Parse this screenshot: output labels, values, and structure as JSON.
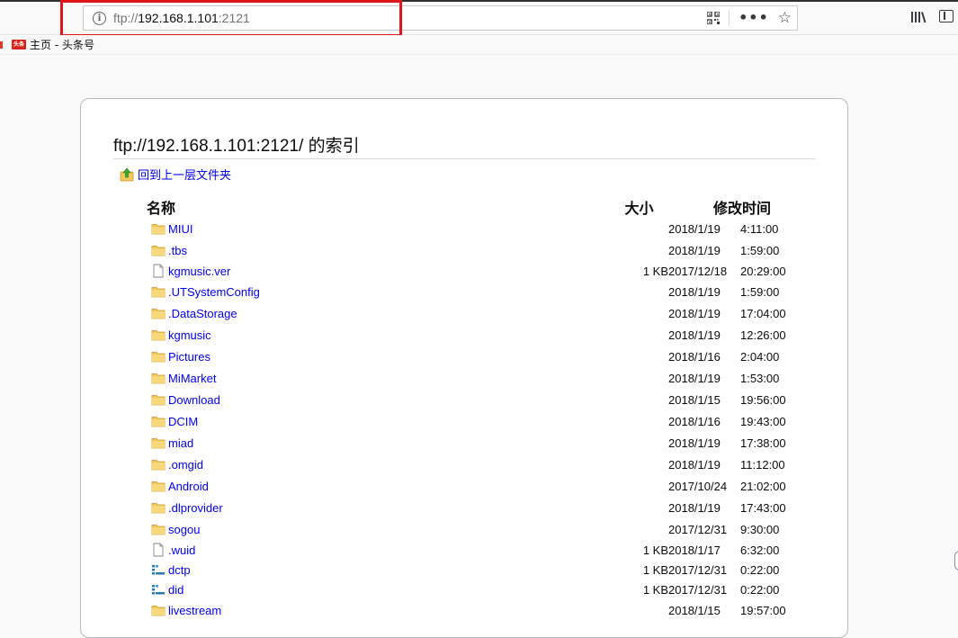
{
  "browser": {
    "url_scheme": "ftp://",
    "url_host": "192.168.1.101",
    "url_port": ":2121",
    "menu_dots": "•••",
    "star": "☆"
  },
  "bookmarks": [
    {
      "label": "主页 - 头条号",
      "favicon_text": "头条"
    }
  ],
  "page": {
    "title": "ftp://192.168.1.101:2121/ 的索引",
    "up_label": "回到上一层文件夹",
    "columns": {
      "name": "名称",
      "size": "大小",
      "modified": "修改时间"
    },
    "entries": [
      {
        "name": "MIUI",
        "type": "folder",
        "size": "",
        "date": "2018/1/19",
        "time": "4:11:00"
      },
      {
        "name": ".tbs",
        "type": "folder",
        "size": "",
        "date": "2018/1/19",
        "time": "1:59:00"
      },
      {
        "name": "kgmusic.ver",
        "type": "file",
        "size": "1 KB",
        "date": "2017/12/18",
        "time": "20:29:00"
      },
      {
        "name": ".UTSystemConfig",
        "type": "folder",
        "size": "",
        "date": "2018/1/19",
        "time": "1:59:00"
      },
      {
        "name": ".DataStorage",
        "type": "folder",
        "size": "",
        "date": "2018/1/19",
        "time": "17:04:00"
      },
      {
        "name": "kgmusic",
        "type": "folder",
        "size": "",
        "date": "2018/1/19",
        "time": "12:26:00"
      },
      {
        "name": "Pictures",
        "type": "folder",
        "size": "",
        "date": "2018/1/16",
        "time": "2:04:00"
      },
      {
        "name": "MiMarket",
        "type": "folder",
        "size": "",
        "date": "2018/1/19",
        "time": "1:53:00"
      },
      {
        "name": "Download",
        "type": "folder",
        "size": "",
        "date": "2018/1/15",
        "time": "19:56:00"
      },
      {
        "name": "DCIM",
        "type": "folder",
        "size": "",
        "date": "2018/1/16",
        "time": "19:43:00"
      },
      {
        "name": "miad",
        "type": "folder",
        "size": "",
        "date": "2018/1/19",
        "time": "17:38:00"
      },
      {
        "name": ".omgid",
        "type": "folder",
        "size": "",
        "date": "2018/1/19",
        "time": "11:12:00"
      },
      {
        "name": "Android",
        "type": "folder",
        "size": "",
        "date": "2017/10/24",
        "time": "21:02:00"
      },
      {
        "name": ".dlprovider",
        "type": "folder",
        "size": "",
        "date": "2018/1/19",
        "time": "17:43:00"
      },
      {
        "name": "sogou",
        "type": "folder",
        "size": "",
        "date": "2017/12/31",
        "time": "9:30:00"
      },
      {
        "name": ".wuid",
        "type": "file",
        "size": "1 KB",
        "date": "2018/1/17",
        "time": "6:32:00"
      },
      {
        "name": "dctp",
        "type": "special",
        "size": "1 KB",
        "date": "2017/12/31",
        "time": "0:22:00"
      },
      {
        "name": "did",
        "type": "special",
        "size": "1 KB",
        "date": "2017/12/31",
        "time": "0:22:00"
      },
      {
        "name": "livestream",
        "type": "folder",
        "size": "",
        "date": "2018/1/15",
        "time": "19:57:00"
      }
    ]
  },
  "colors": {
    "link": "#0000ee",
    "highlight_box": "#e1141c",
    "folder": "#f1c95a"
  }
}
